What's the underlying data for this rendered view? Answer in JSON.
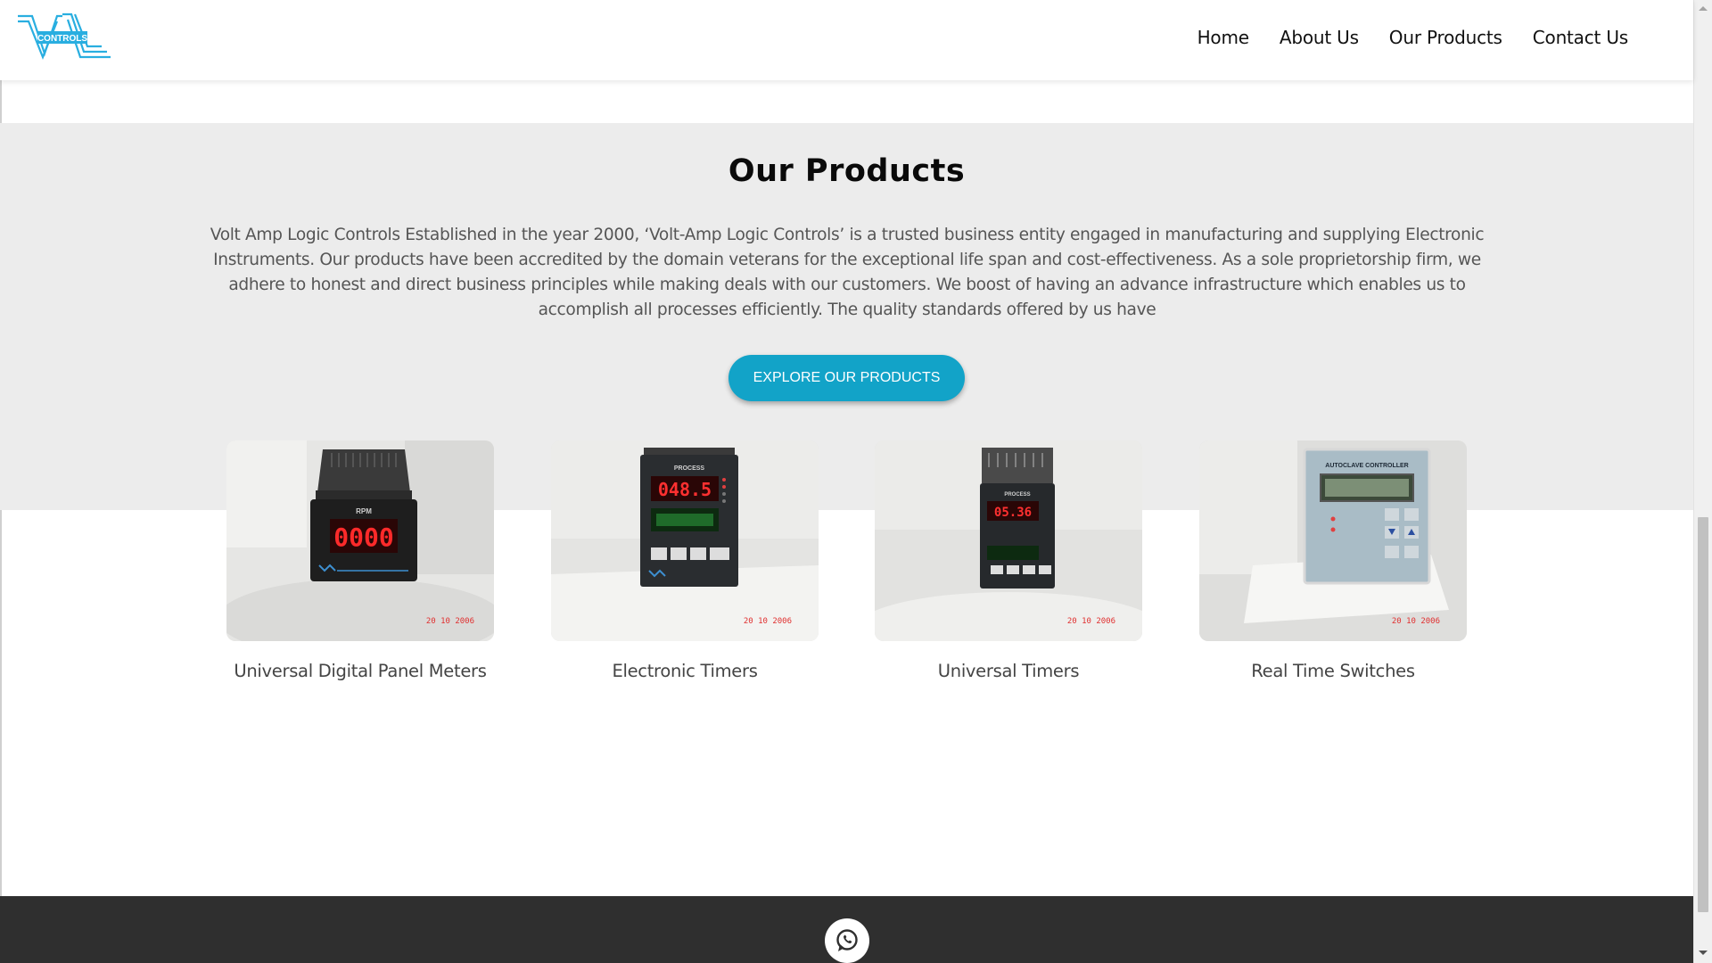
{
  "header": {
    "logo_text": "CONTROLS",
    "nav": [
      {
        "label": "Home"
      },
      {
        "label": "About Us"
      },
      {
        "label": "Our Products"
      },
      {
        "label": "Contact Us"
      }
    ]
  },
  "products_section": {
    "title": "Our Products",
    "description": "Volt Amp Logic Controls Established in the year 2000, ‘Volt-Amp Logic Controls’ is a trusted business entity engaged in manufacturing and supplying Electronic Instruments. Our products have been accredited by the domain veterans for the exceptional life span and cost-effectiveness. As a sole proprietorship firm, we adhere to honest and direct business principles while making deals with our customers. We boost of having an advance infrastructure which enables us to accomplish all processes efficiently. The quality standards offered by us have",
    "button_label": "EXPLORE OUR PRODUCTS",
    "products": [
      {
        "name": "Universal Digital Panel Meters",
        "display": "0000",
        "panel_label": "RPM",
        "date_stamp": "20 10 2006"
      },
      {
        "name": "Electronic Timers",
        "display": "048.5",
        "panel_label": "PROCESS",
        "date_stamp": "20 10 2006"
      },
      {
        "name": "Universal Timers",
        "display": "05.36",
        "panel_label": "PROCESS",
        "date_stamp": "20 10 2006"
      },
      {
        "name": "Real Time Switches",
        "display": "",
        "panel_label": "AUTOCLAVE CONTROLLER",
        "date_stamp": "20 10 2006"
      }
    ]
  },
  "footer": {
    "icon": "whatsapp-icon"
  },
  "colors": {
    "accent": "#12a3c8",
    "band": "#ececec",
    "footer": "#2f2f2f",
    "logo": "#29aee0"
  }
}
